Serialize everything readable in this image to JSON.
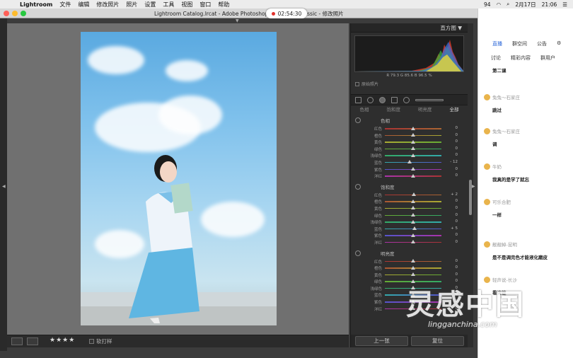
{
  "menubar": {
    "items": [
      "Lightroom",
      "文件",
      "编辑",
      "修改照片",
      "照片",
      "设置",
      "工具",
      "视图",
      "窗口",
      "帮助"
    ],
    "status": {
      "battery": "94",
      "date": "2月17日",
      "time": "21:06"
    }
  },
  "window": {
    "title": "Lightroom Catalog.lrcat - Adobe Photoshop Lightroom Classic - 修改照片",
    "recording_time": "02:54:30"
  },
  "toolbar": {
    "rating": "★★★★",
    "soft_proof": "软打样"
  },
  "right_panel": {
    "header": "直方图 ▼",
    "hist_info": {
      "r_label": "R",
      "r": "79.3",
      "g_label": "G",
      "g": "85.6",
      "b_label": "B",
      "b": "96.5",
      "unit": "%"
    },
    "original_photo": "原始照片",
    "tabs": [
      {
        "label": "色相",
        "active": false
      },
      {
        "label": "饱和度",
        "active": false
      },
      {
        "label": "明亮度",
        "active": false
      },
      {
        "label": "全部",
        "active": true
      }
    ],
    "sections": [
      {
        "title": "色相",
        "rows": [
          {
            "label": "红色",
            "value": "0",
            "pos": 0.5
          },
          {
            "label": "橙色",
            "value": "0",
            "pos": 0.5
          },
          {
            "label": "黄色",
            "value": "0",
            "pos": 0.5
          },
          {
            "label": "绿色",
            "value": "0",
            "pos": 0.5
          },
          {
            "label": "浅绿色",
            "value": "0",
            "pos": 0.5
          },
          {
            "label": "蓝色",
            "value": "- 12",
            "pos": 0.44
          },
          {
            "label": "紫色",
            "value": "0",
            "pos": 0.5
          },
          {
            "label": "洋红",
            "value": "0",
            "pos": 0.5
          }
        ]
      },
      {
        "title": "饱和度",
        "rows": [
          {
            "label": "红色",
            "value": "+ 2",
            "pos": 0.51
          },
          {
            "label": "橙色",
            "value": "0",
            "pos": 0.5
          },
          {
            "label": "黄色",
            "value": "0",
            "pos": 0.5
          },
          {
            "label": "绿色",
            "value": "0",
            "pos": 0.5
          },
          {
            "label": "浅绿色",
            "value": "0",
            "pos": 0.5
          },
          {
            "label": "蓝色",
            "value": "+ 5",
            "pos": 0.53
          },
          {
            "label": "紫色",
            "value": "0",
            "pos": 0.5
          },
          {
            "label": "洋红",
            "value": "0",
            "pos": 0.5
          }
        ]
      },
      {
        "title": "明亮度",
        "rows": [
          {
            "label": "红色",
            "value": "0",
            "pos": 0.5
          },
          {
            "label": "橙色",
            "value": "0",
            "pos": 0.5
          },
          {
            "label": "黄色",
            "value": "0",
            "pos": 0.5
          },
          {
            "label": "绿色",
            "value": "0",
            "pos": 0.5
          },
          {
            "label": "浅绿色",
            "value": "0",
            "pos": 0.5
          },
          {
            "label": "蓝色",
            "value": "0",
            "pos": 0.5
          },
          {
            "label": "紫色",
            "value": "0",
            "pos": 0.5
          },
          {
            "label": "洋红",
            "value": "0",
            "pos": 0.5
          }
        ]
      }
    ],
    "buttons": {
      "prev": "上一张",
      "reset": "复位"
    }
  },
  "chat": {
    "tabs": [
      "直播",
      "群空间",
      "公告"
    ],
    "subtabs": [
      "讨论",
      "精彩内容",
      "群用户"
    ],
    "messages": [
      {
        "who": "",
        "text": "第二课"
      },
      {
        "who": "兔兔～石家庄",
        "text": "跳过"
      },
      {
        "who": "兔兔～石家庄",
        "text": "调"
      },
      {
        "who": "牛奶",
        "text": "我真的是学了就忘"
      },
      {
        "who": "可乐合肥",
        "text": "一样"
      },
      {
        "who": "靓靓掉-昆明",
        "text": "是不是调完色才能液化磨皮"
      },
      {
        "who": "轻声说-长沙",
        "text": "看清楚"
      }
    ]
  },
  "watermark": {
    "text": "灵感中国",
    "url": "lingganchina.com"
  },
  "colors": {
    "accent": "#2a66d8",
    "rec": "#e0312b"
  }
}
